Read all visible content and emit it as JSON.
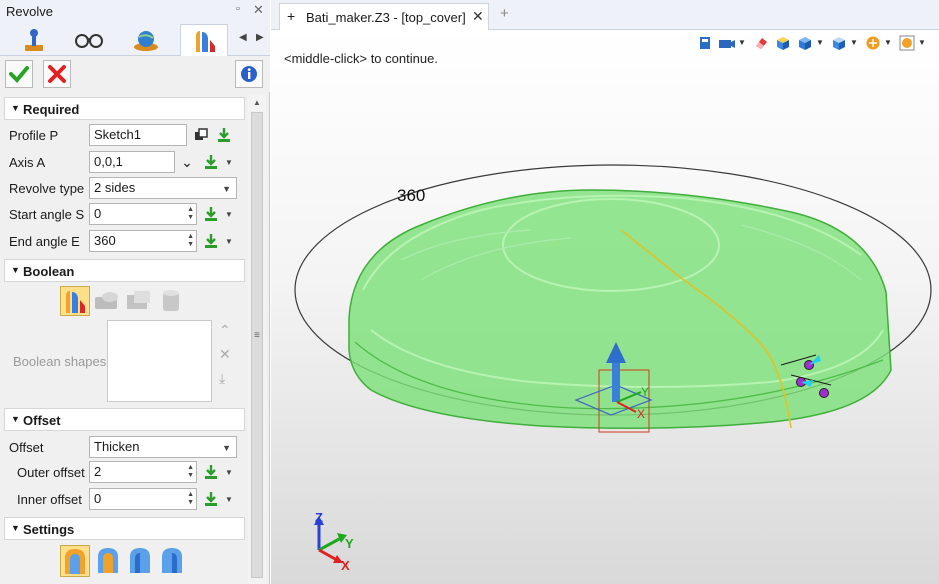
{
  "panel": {
    "title": "Revolve",
    "tabs": [
      {
        "icon": "joystick-icon"
      },
      {
        "icon": "glasses-icon"
      },
      {
        "icon": "globe-icon"
      },
      {
        "icon": "revolve-feature-icon"
      }
    ],
    "info_icon": "info-icon",
    "ok_icon": "checkmark-icon",
    "cancel_icon": "x-icon"
  },
  "required": {
    "header": "Required",
    "profile_label": "Profile P",
    "profile_value": "Sketch1",
    "axis_label": "Axis A",
    "axis_value": "0,0,1",
    "revolve_type_label": "Revolve type",
    "revolve_type_value": "2 sides",
    "start_angle_label": "Start angle S",
    "start_angle_value": "0",
    "end_angle_label": "End angle E",
    "end_angle_value": "360"
  },
  "boolean": {
    "header": "Boolean",
    "shapes_label": "Boolean shapes"
  },
  "offset": {
    "header": "Offset",
    "offset_label": "Offset",
    "offset_value": "Thicken",
    "outer_label": "Outer offset",
    "outer_value": "2",
    "inner_label": "Inner offset",
    "inner_value": "0"
  },
  "settings": {
    "header": "Settings"
  },
  "viewport": {
    "doc_tab_label": "Bati_maker.Z3 - [top_cover]",
    "prompt": "<middle-click> to continue.",
    "angle_label": "360",
    "triad": {
      "x": "X",
      "y": "Y",
      "z": "Z"
    },
    "colors": {
      "part_fill": "#7ee07a",
      "part_edge": "#3fae3a",
      "axis_x": "#e02020",
      "axis_y": "#1fa81f",
      "axis_z": "#2a3fd6"
    }
  }
}
